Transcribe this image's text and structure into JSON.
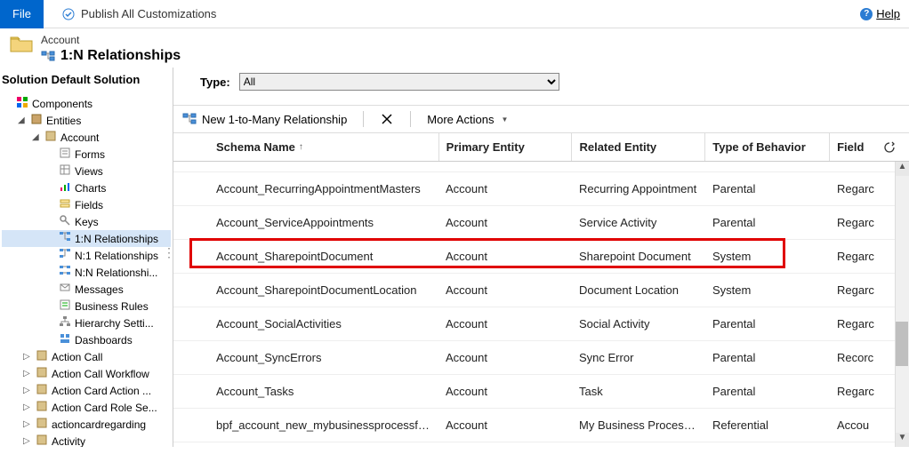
{
  "topbar": {
    "file_label": "File",
    "publish_label": "Publish All Customizations",
    "help_label": "Help"
  },
  "header": {
    "breadcrumb": "Account",
    "title": "1:N Relationships"
  },
  "sidebar": {
    "title": "Solution Default Solution",
    "tree": [
      {
        "label": "Components",
        "indent": 0,
        "icon": "components-icon",
        "expander": ""
      },
      {
        "label": "Entities",
        "indent": 1,
        "icon": "entities-icon",
        "expander": "◢"
      },
      {
        "label": "Account",
        "indent": 2,
        "icon": "entity-icon",
        "expander": "◢"
      },
      {
        "label": "Forms",
        "indent": 3,
        "icon": "forms-icon",
        "expander": ""
      },
      {
        "label": "Views",
        "indent": 3,
        "icon": "views-icon",
        "expander": ""
      },
      {
        "label": "Charts",
        "indent": 3,
        "icon": "charts-icon",
        "expander": ""
      },
      {
        "label": "Fields",
        "indent": 3,
        "icon": "fields-icon",
        "expander": ""
      },
      {
        "label": "Keys",
        "indent": 3,
        "icon": "keys-icon",
        "expander": ""
      },
      {
        "label": "1:N Relationships",
        "indent": 3,
        "icon": "rel1n-icon",
        "expander": "",
        "selected": true
      },
      {
        "label": "N:1 Relationships",
        "indent": 3,
        "icon": "reln1-icon",
        "expander": ""
      },
      {
        "label": "N:N Relationshi...",
        "indent": 3,
        "icon": "relnn-icon",
        "expander": ""
      },
      {
        "label": "Messages",
        "indent": 3,
        "icon": "messages-icon",
        "expander": ""
      },
      {
        "label": "Business Rules",
        "indent": 3,
        "icon": "bizrules-icon",
        "expander": ""
      },
      {
        "label": "Hierarchy Setti...",
        "indent": 3,
        "icon": "hierarchy-icon",
        "expander": ""
      },
      {
        "label": "Dashboards",
        "indent": 3,
        "icon": "dashboards-icon",
        "expander": ""
      },
      {
        "label": "Action Call",
        "indent": "1b",
        "icon": "entity-icon",
        "expander": "▷"
      },
      {
        "label": "Action Call Workflow",
        "indent": "1b",
        "icon": "entity-icon",
        "expander": "▷"
      },
      {
        "label": "Action Card Action ...",
        "indent": "1b",
        "icon": "entity-icon",
        "expander": "▷"
      },
      {
        "label": "Action Card Role Se...",
        "indent": "1b",
        "icon": "entity-icon",
        "expander": "▷"
      },
      {
        "label": "actioncardregarding",
        "indent": "1b",
        "icon": "entity-icon",
        "expander": "▷"
      },
      {
        "label": "Activity",
        "indent": "1b",
        "icon": "entity-icon",
        "expander": "▷"
      }
    ]
  },
  "filter": {
    "type_label": "Type:",
    "type_value": "All"
  },
  "toolbar": {
    "new_label": "New 1-to-Many Relationship",
    "delete_label": "",
    "more_label": "More Actions"
  },
  "grid": {
    "columns": {
      "schema": "Schema Name",
      "primary": "Primary Entity",
      "related": "Related Entity",
      "behavior": "Type of Behavior",
      "field": "Field"
    },
    "rows": [
      {
        "schema": "Account_RecurringAppointmentMasters",
        "primary": "Account",
        "related": "Recurring Appointment",
        "behavior": "Parental",
        "field": "Regarc"
      },
      {
        "schema": "Account_ServiceAppointments",
        "primary": "Account",
        "related": "Service Activity",
        "behavior": "Parental",
        "field": "Regarc"
      },
      {
        "schema": "Account_SharepointDocument",
        "primary": "Account",
        "related": "Sharepoint Document",
        "behavior": "System",
        "field": "Regarc",
        "highlight": true
      },
      {
        "schema": "Account_SharepointDocumentLocation",
        "primary": "Account",
        "related": "Document Location",
        "behavior": "System",
        "field": "Regarc"
      },
      {
        "schema": "Account_SocialActivities",
        "primary": "Account",
        "related": "Social Activity",
        "behavior": "Parental",
        "field": "Regarc"
      },
      {
        "schema": "Account_SyncErrors",
        "primary": "Account",
        "related": "Sync Error",
        "behavior": "Parental",
        "field": "Recorc"
      },
      {
        "schema": "Account_Tasks",
        "primary": "Account",
        "related": "Task",
        "behavior": "Parental",
        "field": "Regarc"
      },
      {
        "schema": "bpf_account_new_mybusinessprocessflow",
        "primary": "Account",
        "related": "My Business Process F...",
        "behavior": "Referential",
        "field": "Accou"
      }
    ]
  }
}
